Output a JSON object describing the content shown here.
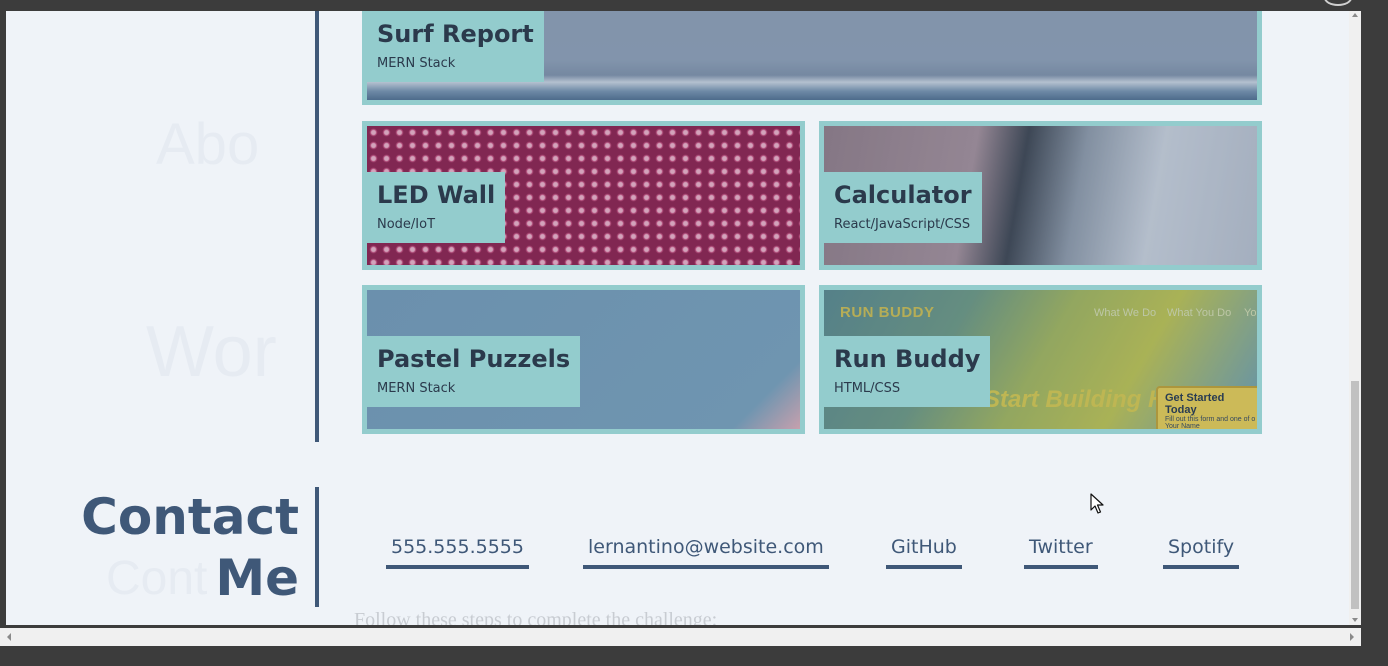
{
  "colors": {
    "accent": "#93cccd",
    "primary": "#3f5878",
    "page_background": "#eff3f8"
  },
  "projects": [
    {
      "title": "Surf Report",
      "stack": "MERN Stack"
    },
    {
      "title": "LED Wall",
      "stack": "Node/IoT"
    },
    {
      "title": "Calculator",
      "stack": "React/JavaScript/CSS"
    },
    {
      "title": "Pastel Puzzels",
      "stack": "MERN Stack"
    },
    {
      "title": "Run Buddy",
      "stack": "HTML/CSS"
    }
  ],
  "run_buddy_preview": {
    "logo": "RUN BUDDY",
    "nav": [
      "What We Do",
      "What You Do",
      "Yo"
    ],
    "hero": "Start Building Habits",
    "form_title": "Get Started Today",
    "form_sub": "Fill out this form and one of o",
    "form_field": "Your Name"
  },
  "contact": {
    "heading": "Contact Me",
    "links": [
      {
        "label": "555.555.5555"
      },
      {
        "label": "lernantino@website.com"
      },
      {
        "label": "GitHub"
      },
      {
        "label": "Twitter"
      },
      {
        "label": "Spotify"
      }
    ]
  },
  "underlay_text": "Follow these steps to complete the challenge:",
  "icons": {
    "cursor": "arrow-cursor-icon",
    "scroll_up": "scroll-up-arrow-icon",
    "scroll_down": "scroll-down-arrow-icon",
    "scroll_left": "scroll-left-arrow-icon",
    "scroll_right": "scroll-right-arrow-icon"
  }
}
